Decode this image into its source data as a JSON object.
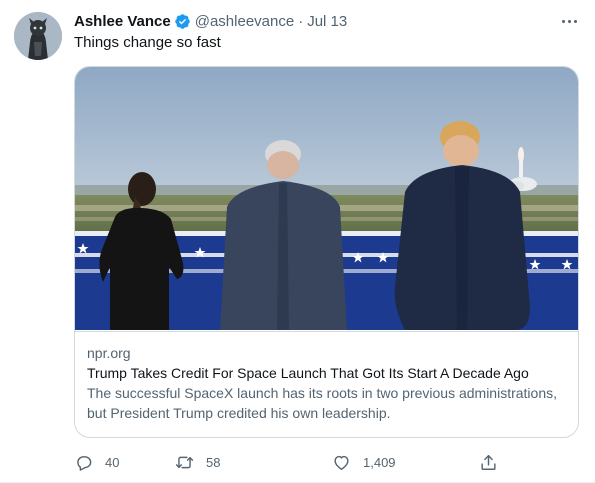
{
  "tweet": {
    "author_name": "Ashlee Vance",
    "handle": "@ashleevance",
    "separator": "·",
    "timestamp": "Jul 13",
    "text": "Things change so fast",
    "avatar_icon": "user-avatar-icon",
    "verified_icon": "verified-badge-icon"
  },
  "card": {
    "domain": "npr.org",
    "title": "Trump Takes Credit For Space Launch That Got Its Start A Decade Ago",
    "description": "The successful SpaceX launch has its roots in two previous administrations, but President Trump credited his own leadership."
  },
  "actions": {
    "reply_count": "40",
    "retweet_count": "58",
    "like_count": "1,409"
  },
  "colors": {
    "accent": "#1d9bf0",
    "secondary_text": "#536471",
    "primary_text": "#0f1419",
    "border": "#cfd9de"
  }
}
